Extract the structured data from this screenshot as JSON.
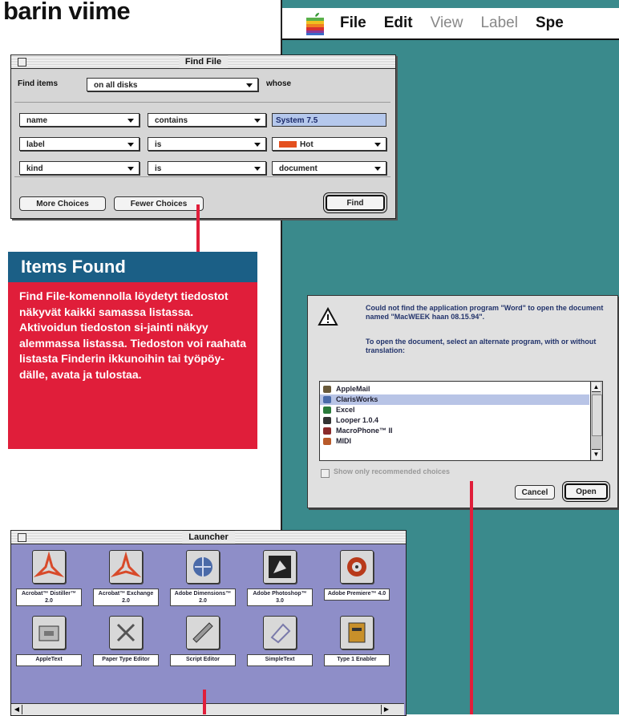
{
  "heading": "barin viime",
  "menubar": {
    "items": [
      "File",
      "Edit",
      "View",
      "Label",
      "Spe"
    ]
  },
  "find_file": {
    "title": "Find File",
    "find_items_label": "Find items",
    "location": "on all disks",
    "whose_label": "whose",
    "criteria": [
      {
        "attr": "name",
        "op": "contains",
        "value": "System 7.5"
      },
      {
        "attr": "label",
        "op": "is",
        "value": "Hot"
      },
      {
        "attr": "kind",
        "op": "is",
        "value": "document"
      }
    ],
    "more_choices": "More Choices",
    "fewer_choices": "Fewer Choices",
    "find_button": "Find"
  },
  "items_found": {
    "title": "Items Found",
    "body": "Find File-komennolla löydetyt tiedostot näkyvät kaikki samassa listassa. Aktivoidun tiedoston si-jainti näkyy alemmassa listassa. Tiedoston voi raahata listasta Finderin ikkunoihin tai työpöy-dälle, avata ja tulostaa."
  },
  "dialog": {
    "message_1": "Could not find the application program \"Word\" to open the document named \"MacWEEK haan 08.15.94\".",
    "message_2": "To open the document, select an alternate program, with or without translation:",
    "list": [
      {
        "name": "AppleMail",
        "color": "#6a5a3a"
      },
      {
        "name": "ClarisWorks",
        "color": "#4a6aa8"
      },
      {
        "name": "Excel",
        "color": "#2a7a3a"
      },
      {
        "name": "Looper 1.0.4",
        "color": "#333333"
      },
      {
        "name": "MacroPhone™ II",
        "color": "#8a2a2a"
      },
      {
        "name": "MIDI",
        "color": "#b85a2a"
      }
    ],
    "checkbox_label": "Show only recommended choices",
    "cancel": "Cancel",
    "open": "Open"
  },
  "launcher": {
    "title": "Launcher",
    "apps": [
      {
        "caption": "Acrobat™ Distiller™ 2.0",
        "icon": "acrobat-icon",
        "color": "#d84a2a"
      },
      {
        "caption": "Acrobat™ Exchange 2.0",
        "icon": "acrobat-icon",
        "color": "#d84a2a"
      },
      {
        "caption": "Adobe Dimensions™ 2.0",
        "icon": "dimensions-icon",
        "color": "#4a6aa8"
      },
      {
        "caption": "Adobe Photoshop™ 3.0",
        "icon": "photoshop-icon",
        "color": "#333333"
      },
      {
        "caption": "Adobe Premiere™ 4.0",
        "icon": "premiere-icon",
        "color": "#b83a1a"
      },
      {
        "caption": "AppleText",
        "icon": "text-icon",
        "color": "#777777"
      },
      {
        "caption": "Paper Type Editor",
        "icon": "tools-icon",
        "color": "#666666"
      },
      {
        "caption": "Script Editor",
        "icon": "script-icon",
        "color": "#777777"
      },
      {
        "caption": "SimpleText",
        "icon": "simpletext-icon",
        "color": "#7a7aaa"
      },
      {
        "caption": "Type 1 Enabler",
        "icon": "enabler-icon",
        "color": "#c8902a"
      }
    ]
  }
}
